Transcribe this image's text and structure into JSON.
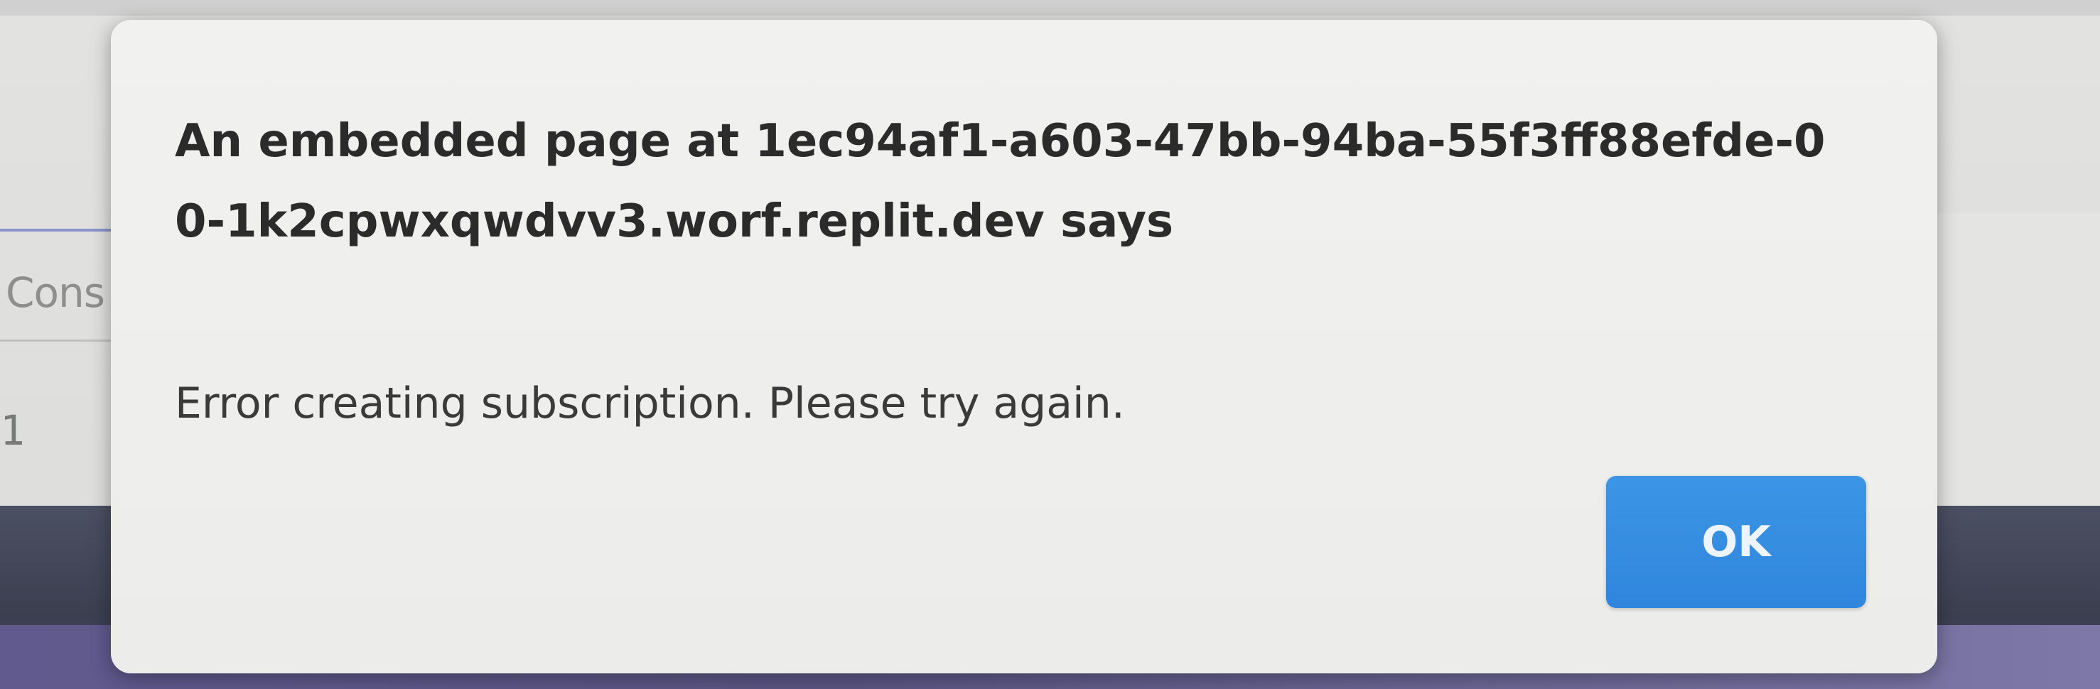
{
  "background": {
    "console_tab_label": "Cons",
    "line_number": "1"
  },
  "dialog": {
    "heading": "An embedded page at 1ec94af1-a603-47bb-94ba-55f3ff88efde-00-1k2cpwxqwdvv3.worf.replit.dev says",
    "message": "Error creating subscription. Please try again.",
    "ok_label": "OK"
  },
  "colors": {
    "button_accent": "#3d95e6",
    "dialog_background": "#efefed",
    "heading_text": "#2b2b2b"
  }
}
